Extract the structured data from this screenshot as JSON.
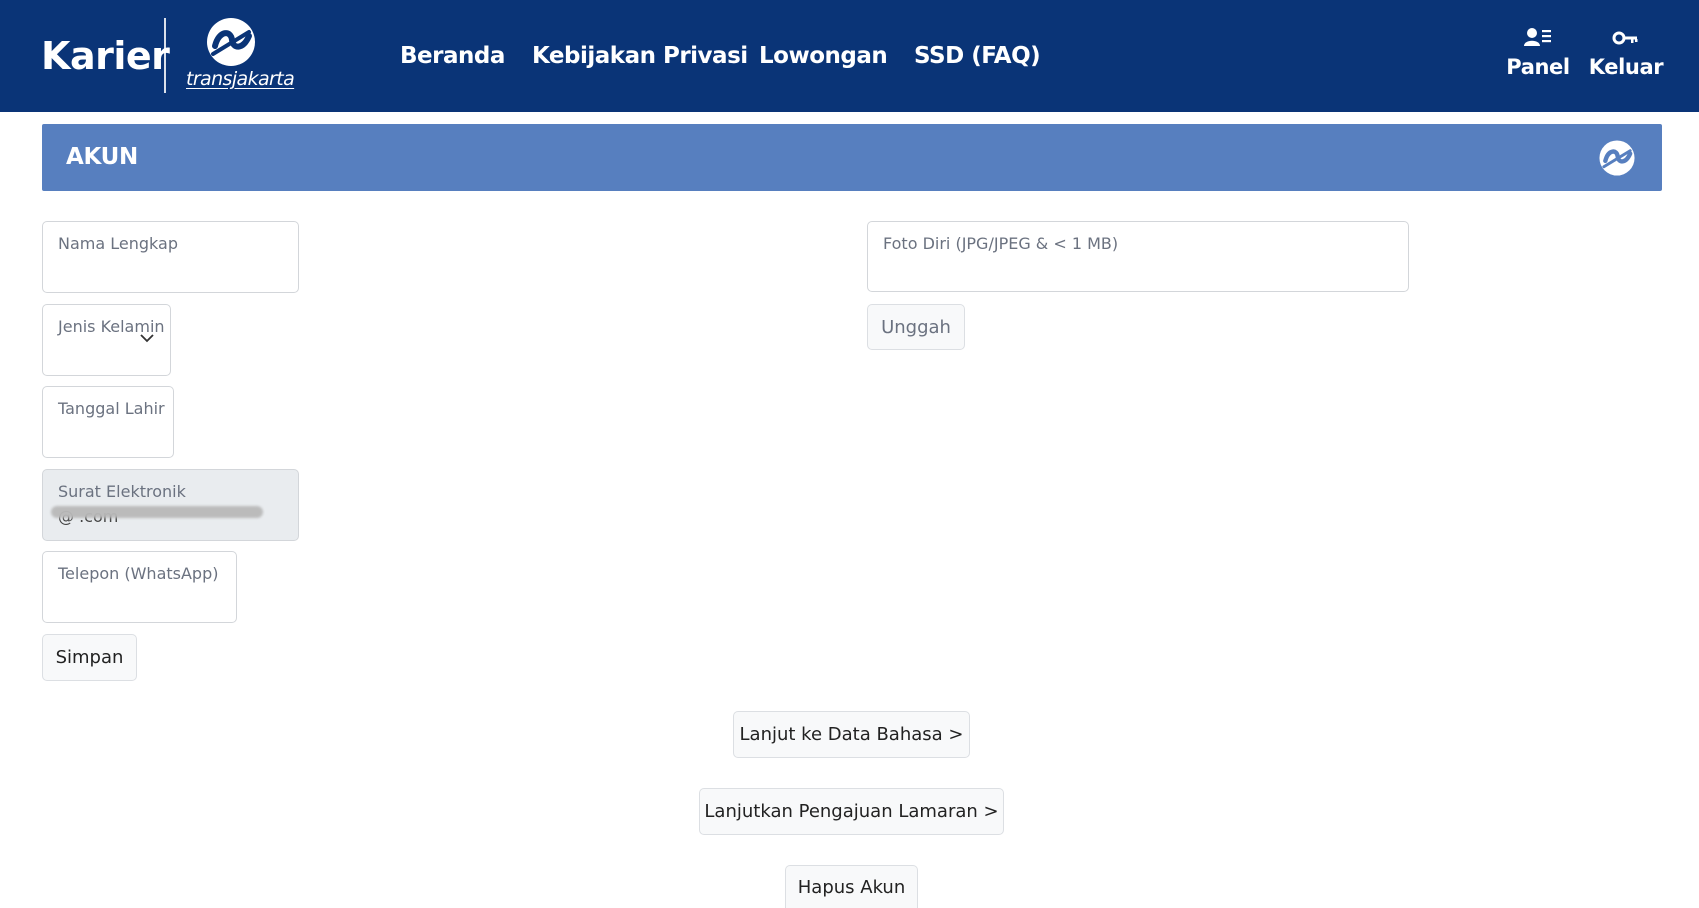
{
  "header": {
    "brand": "Karier",
    "logo_wordmark": "transjakarta",
    "nav": [
      "Beranda",
      "Kebijakan Privasi",
      "Lowongan",
      "SSD (FAQ)"
    ],
    "actions": {
      "panel": "Panel",
      "keluar": "Keluar"
    },
    "icons": {
      "panel": "user-list-icon",
      "keluar": "key-icon"
    },
    "background_color": "#0a3477"
  },
  "banner": {
    "title": "AKUN",
    "background_color": "#577fbf"
  },
  "form": {
    "nama_lengkap": {
      "label": "Nama Lengkap",
      "value": ""
    },
    "jenis_kelamin": {
      "label": "Jenis Kelamin",
      "value": ""
    },
    "tanggal_lahir": {
      "label": "Tanggal Lahir",
      "value": ""
    },
    "surat_elektronik": {
      "label": "Surat Elektronik",
      "value": "@          .com"
    },
    "telepon": {
      "label": "Telepon (WhatsApp)",
      "value": ""
    },
    "foto_diri": {
      "label": "Foto Diri (JPG/JPEG & < 1 MB)",
      "value": ""
    },
    "unggah_label": "Unggah",
    "simpan_label": "Simpan"
  },
  "actions": {
    "lanjut_bahasa": "Lanjut ke Data Bahasa >",
    "lanjut_lamaran": "Lanjutkan Pengajuan Lamaran >",
    "hapus_akun": "Hapus Akun"
  }
}
